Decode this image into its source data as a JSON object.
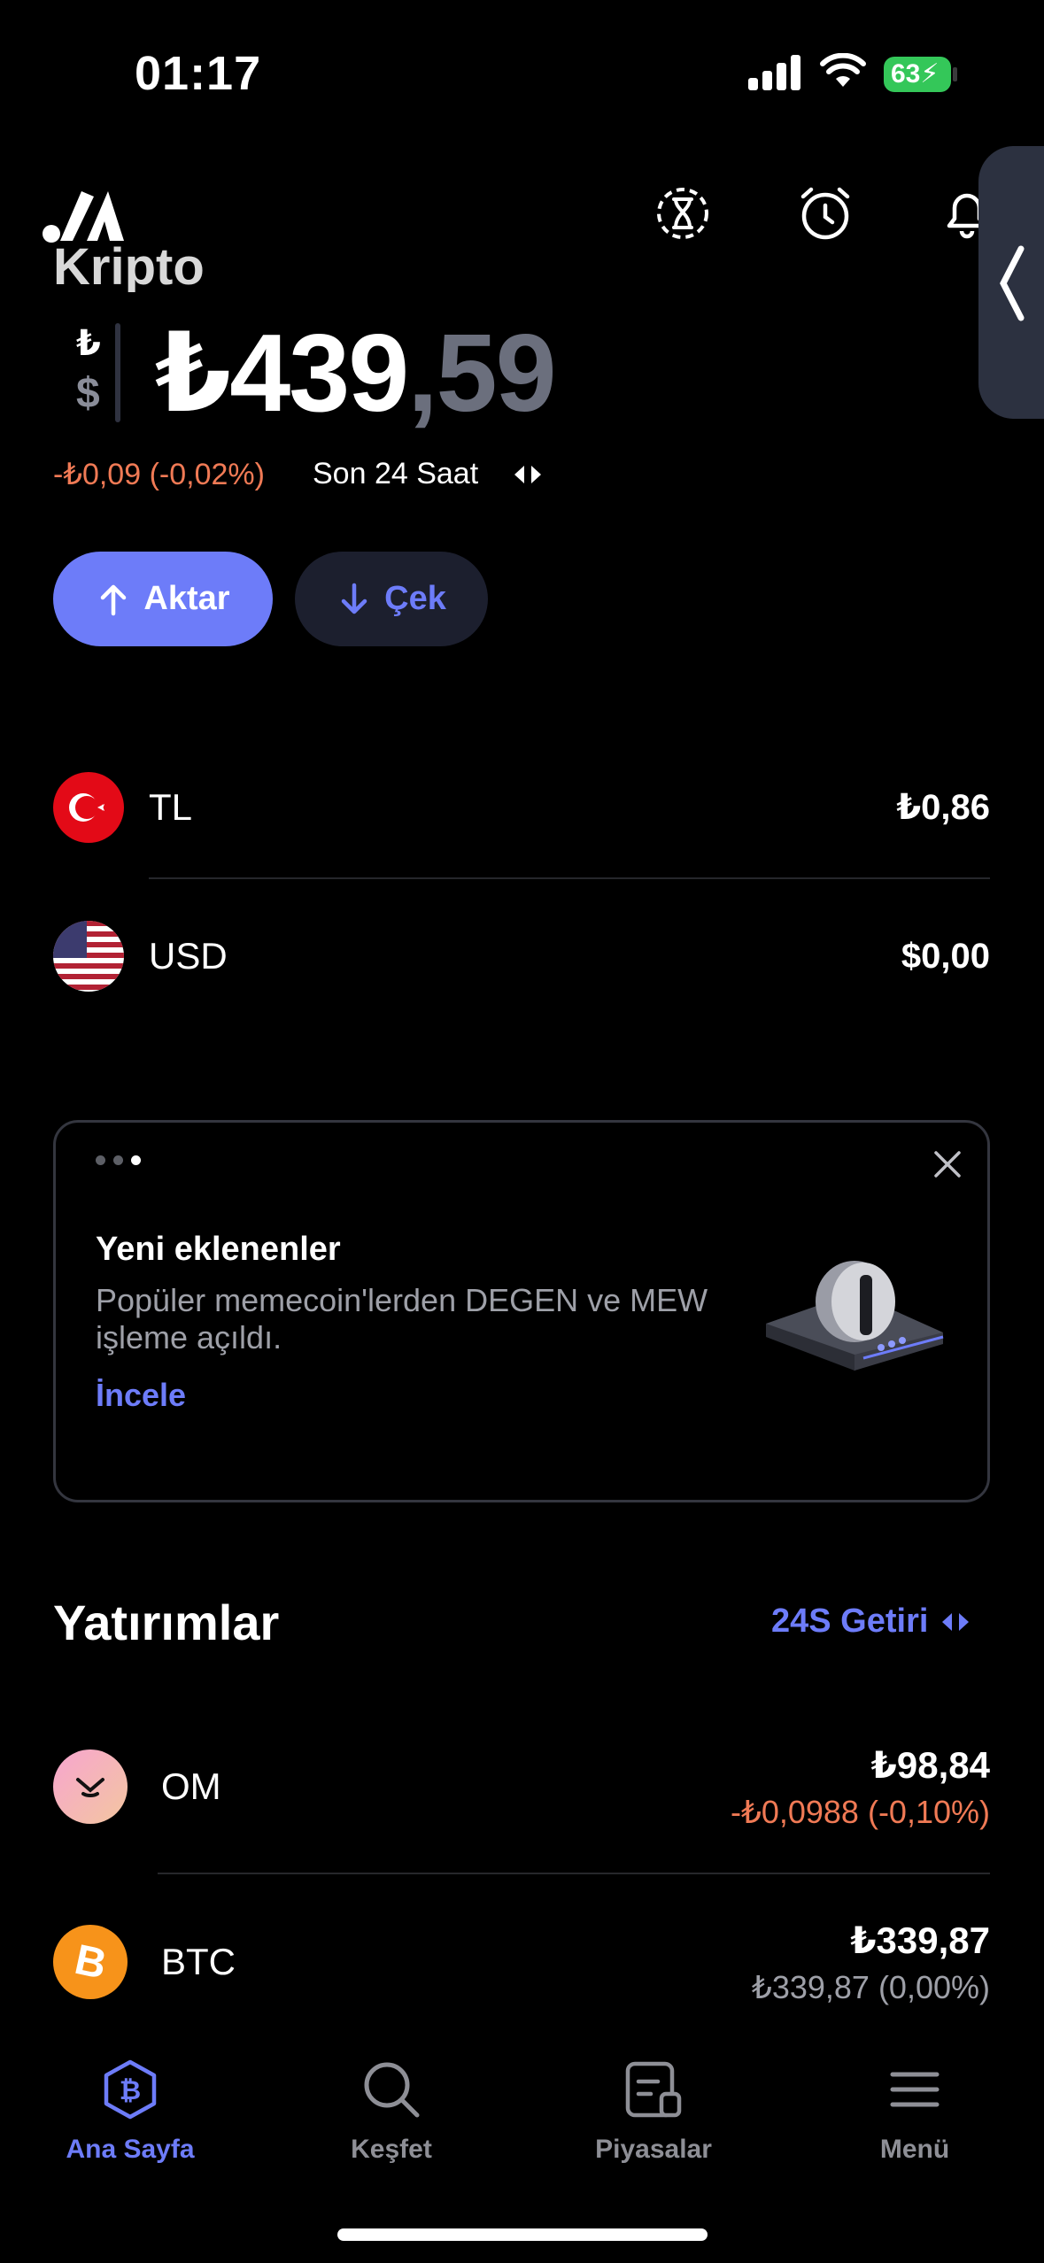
{
  "status": {
    "time": "01:17",
    "battery": "63"
  },
  "header": {
    "section_title": "Kripto"
  },
  "balance": {
    "whole": "₺439",
    "decimal": ",59",
    "toggle_top": "₺",
    "toggle_bottom": "$"
  },
  "change": {
    "value": "-₺0,09 (-0,02%)",
    "period": "Son 24 Saat"
  },
  "actions": {
    "send": "Aktar",
    "withdraw": "Çek"
  },
  "currencies": [
    {
      "name": "TL",
      "value": "₺0,86"
    },
    {
      "name": "USD",
      "value": "$0,00"
    }
  ],
  "banner": {
    "title": "Yeni eklenenler",
    "text": "Popüler memecoin'lerden DEGEN ve MEW işleme açıldı.",
    "link": "İncele"
  },
  "investments": {
    "title": "Yatırımlar",
    "toggle": "24S Getiri",
    "items": [
      {
        "name": "OM",
        "value": "₺98,84",
        "change": "-₺0,0988 (-0,10%)",
        "change_color": "#f07a55",
        "icon_color": "#f3a6c8"
      },
      {
        "name": "BTC",
        "value": "₺339,87",
        "change": "₺339,87 (0,00%)",
        "change_color": "#9ea0a8",
        "icon_color": "#f7931a"
      }
    ]
  },
  "tabs": [
    {
      "label": "Ana Sayfa",
      "icon": "bitcoin-shield-icon"
    },
    {
      "label": "Keşfet",
      "icon": "search-icon"
    },
    {
      "label": "Piyasalar",
      "icon": "markets-icon"
    },
    {
      "label": "Menü",
      "icon": "menu-icon"
    }
  ],
  "colors": {
    "accent": "#6d7cf9",
    "negative": "#f07a55",
    "background": "#000000"
  }
}
